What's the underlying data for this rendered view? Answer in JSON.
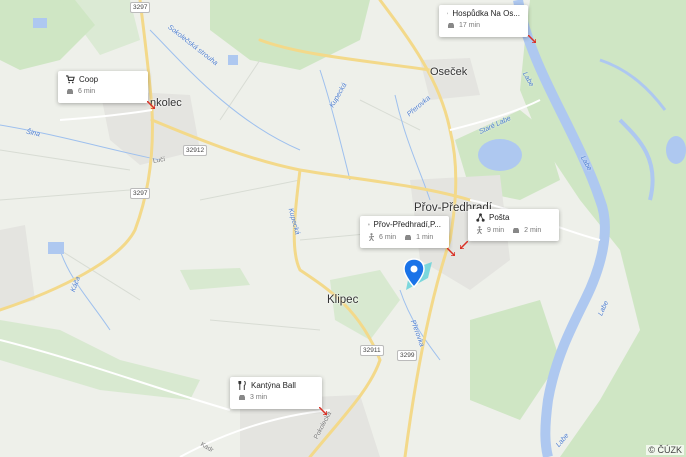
{
  "map": {
    "copyright": "© ČÚZK",
    "colors": {
      "water": "#aec8f0",
      "green": "#cfe6c4",
      "road_major": "#f3d98a",
      "pin": "#1a73e8"
    }
  },
  "places": {
    "osecek": "Oseček",
    "prerov": "Přov-Předhradí",
    "klipec": "Klipec",
    "kolec": "nkolec"
  },
  "water_labels": {
    "sokolecka": "Sokolečská strouha",
    "sina": "Šina",
    "luci": "Lučí",
    "kupecka1": "Kupecká",
    "kupecka2": "Kupecká",
    "prerovka1": "Přerovka",
    "prerovka2": "Přerovka",
    "stare_labe": "Staré Labe",
    "labe1": "Labe",
    "labe2": "Labe",
    "labe3": "Labe",
    "labe4": "Labe",
    "kaca": "Káča"
  },
  "road_labels": {
    "pokolecka": "Pokolecká",
    "kadr": "Kadr"
  },
  "road_numbers": {
    "r3297a": "3297",
    "r3297b": "3297",
    "r32912": "32912",
    "r32911": "32911",
    "r3299": "3299"
  },
  "cards": {
    "coop": {
      "icon": "cart-icon",
      "title": "Coop",
      "time": "6 min"
    },
    "hospudka": {
      "icon": "fork-knife-icon",
      "title": "Hospůdka Na Os...",
      "time": "17 min"
    },
    "bus": {
      "icon": "bus-icon",
      "title": "Přov-Předhradí,P...",
      "walk": "6 min",
      "car": "1 min"
    },
    "posta": {
      "icon": "network-icon",
      "title": "Pošta",
      "walk": "9 min",
      "car": "2 min"
    },
    "kantyna": {
      "icon": "fork-knife-icon",
      "title": "Kantýna Ball",
      "time": "3 min"
    }
  }
}
